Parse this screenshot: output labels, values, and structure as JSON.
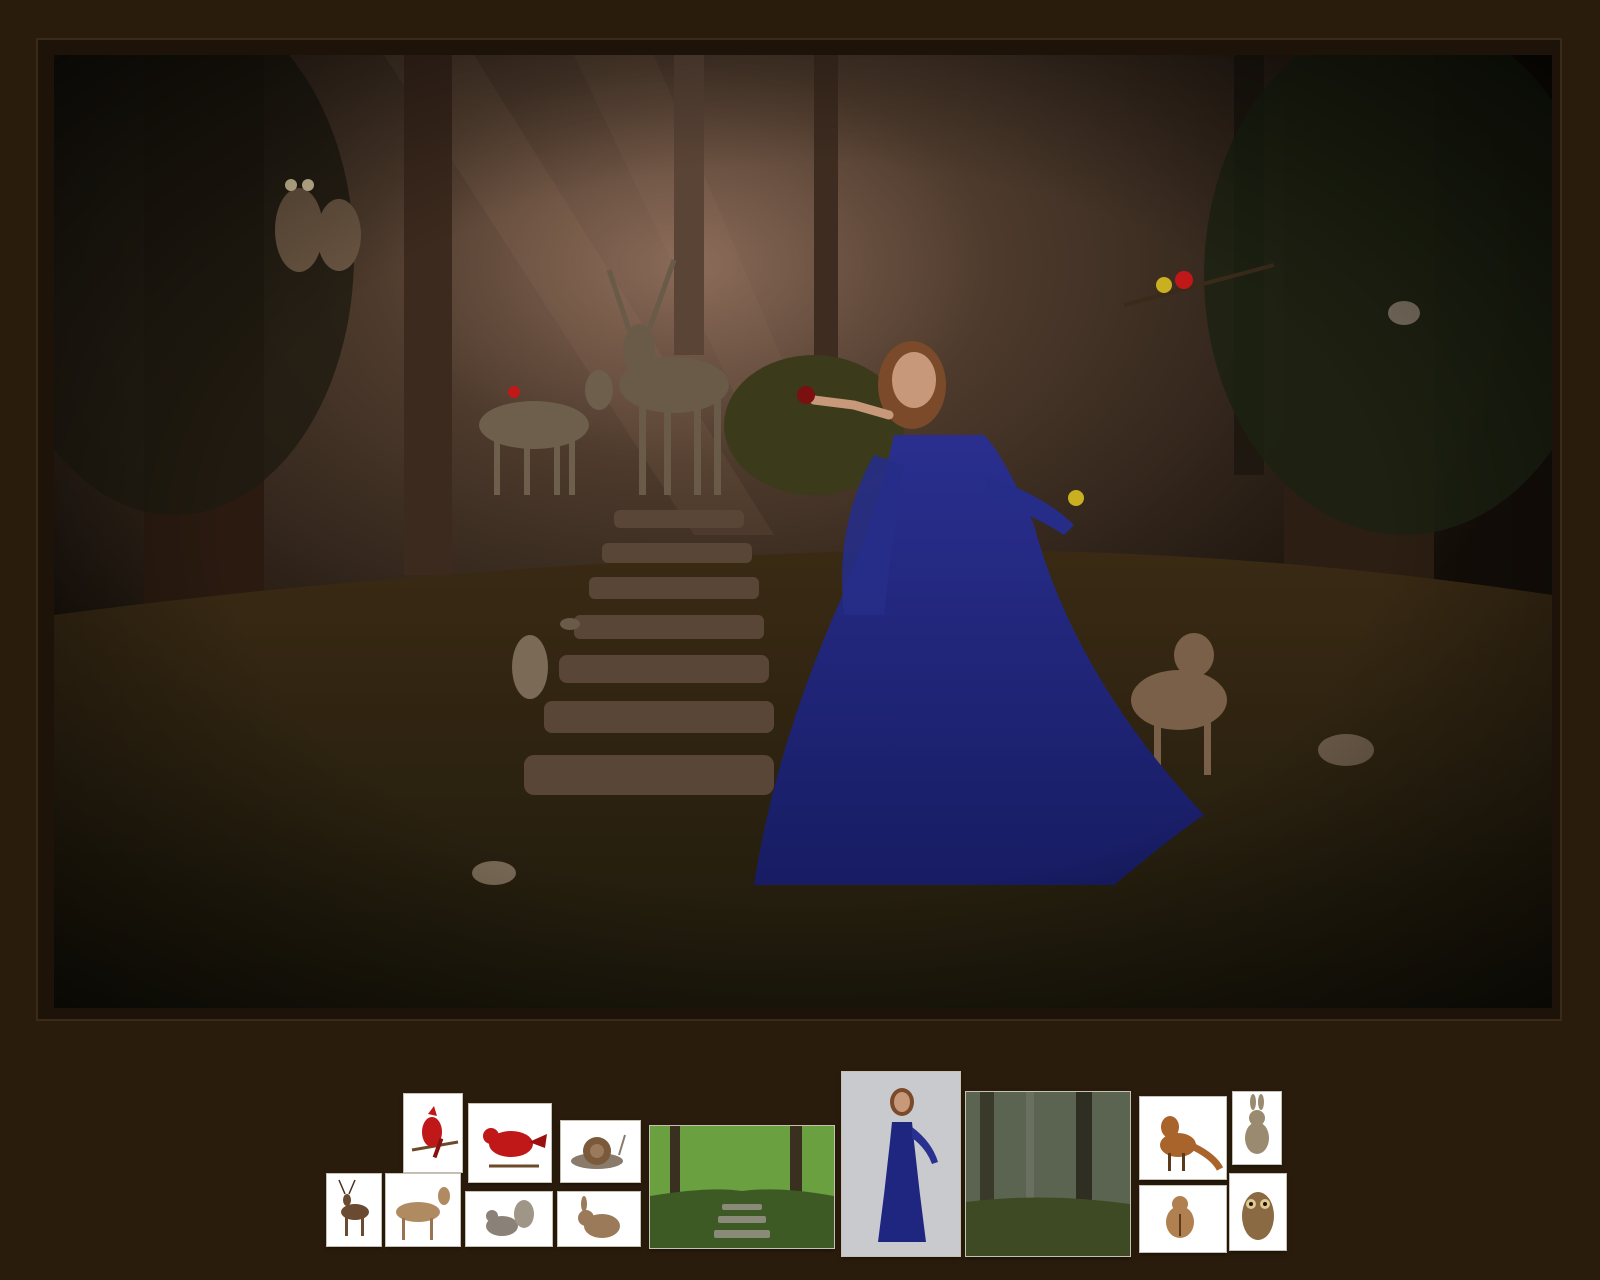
{
  "composite": {
    "subject": "woman-in-blue-gown-forest-fantasy",
    "elements": [
      "owl-pair",
      "deer-buck",
      "deer-doe",
      "cardinal",
      "rabbit",
      "snail",
      "chipmunk",
      "fox",
      "goldfinch",
      "squirrel",
      "stone-steps",
      "forest-trees"
    ]
  },
  "source_images": [
    {
      "id": "cardinal-on-branch",
      "kind": "animal"
    },
    {
      "id": "cardinal-perched",
      "kind": "animal"
    },
    {
      "id": "snail",
      "kind": "animal"
    },
    {
      "id": "deer-buck",
      "kind": "animal"
    },
    {
      "id": "deer-doe",
      "kind": "animal"
    },
    {
      "id": "squirrel",
      "kind": "animal"
    },
    {
      "id": "rabbit-sitting",
      "kind": "animal"
    },
    {
      "id": "forest-stone-path",
      "kind": "background"
    },
    {
      "id": "model-blue-dress",
      "kind": "portrait"
    },
    {
      "id": "misty-forest",
      "kind": "background"
    },
    {
      "id": "fox",
      "kind": "animal"
    },
    {
      "id": "rabbit-standing",
      "kind": "animal"
    },
    {
      "id": "chipmunk",
      "kind": "animal"
    },
    {
      "id": "owl",
      "kind": "animal"
    }
  ],
  "colors": {
    "page_bg": "#2a1c0c",
    "frame_bg": "#1e1308",
    "gown": "#1f2680",
    "foliage": "#3b3a1a",
    "fur": "#7a6a56",
    "cardinal": "#c01818"
  }
}
